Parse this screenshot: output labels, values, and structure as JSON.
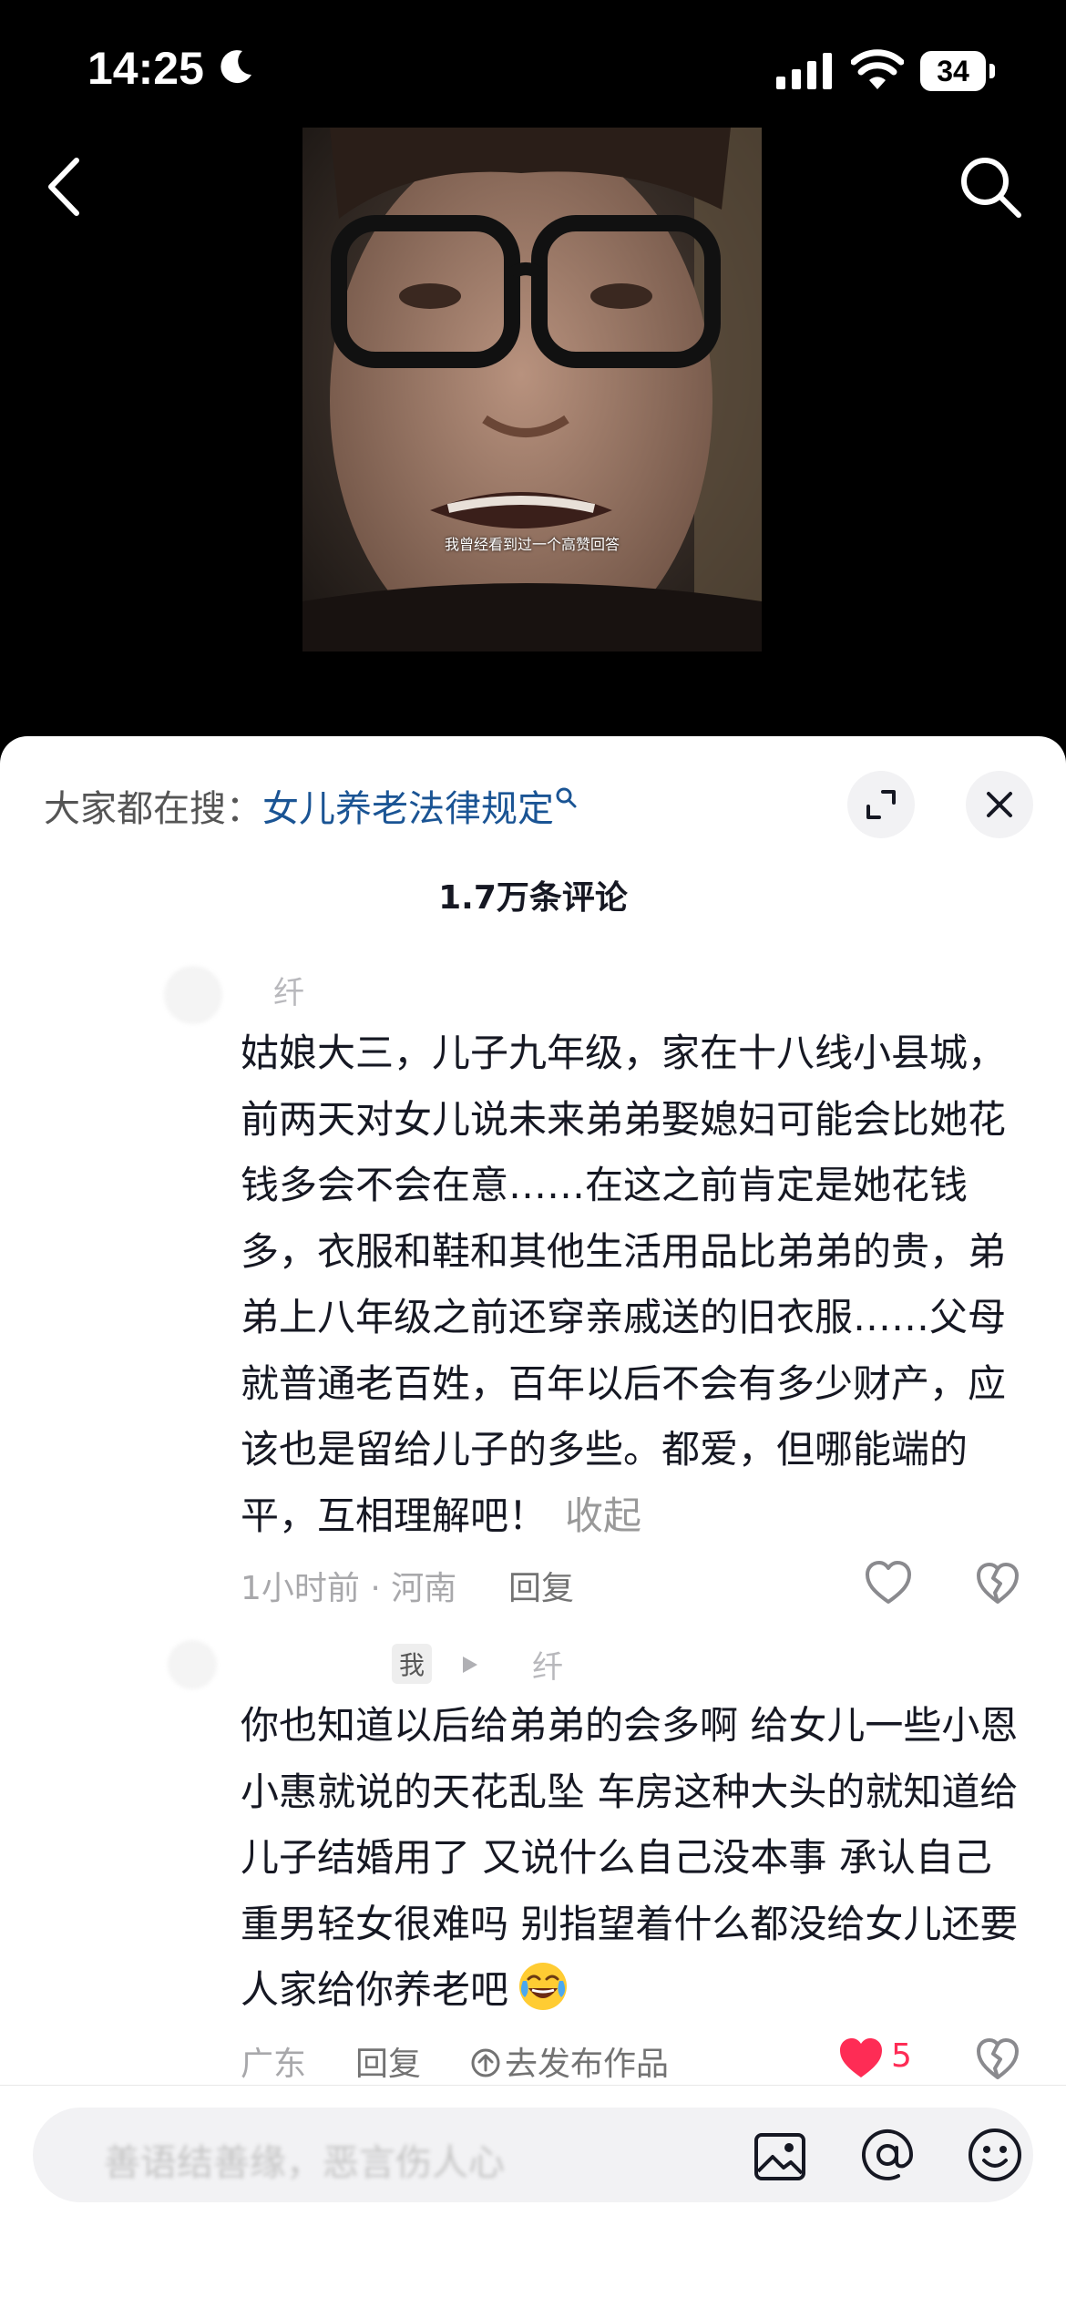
{
  "status_bar": {
    "time": "14:25",
    "battery": "34"
  },
  "video": {
    "subtitle": "我曾经看到过一个高赞回答"
  },
  "hot_search": {
    "label": "大家都在搜：",
    "query": "女儿养老法律规定"
  },
  "comments_header": {
    "count_label": "1.7万条评论"
  },
  "comments": [
    {
      "username": "纤",
      "text": "姑娘大三，儿子九年级，家在十八线小县城，前两天对女儿说未来弟弟娶媳妇可能会比她花钱多会不会在意……在这之前肯定是她花钱多，衣服和鞋和其他生活用品比弟弟的贵，弟弟上八年级之前还穿亲戚送的旧衣服……父母就普通老百姓，百年以后不会有多少财产，应该也是留给儿子的多些。都爱，但哪能端的平，互相理解吧！",
      "collapse_label": "收起",
      "meta": "1小时前 · 河南",
      "reply_label": "回复"
    },
    {
      "me_tag": "我",
      "reply_to": "纤",
      "text": "你也知道以后给弟弟的会多啊 给女儿一些小恩小惠就说的天花乱坠 车房这种大头的就知道给儿子结婚用了 又说什么自己没本事 承认自己重男轻女很难吗 别指望着什么都没给女儿还要人家给你养老吧",
      "location": "广东",
      "reply_label": "回复",
      "publish_label": "去发布作品",
      "likes": "5"
    }
  ],
  "input_bar": {
    "placeholder": "善语结善缘，恶言伤人心"
  },
  "colors": {
    "accent": "#fe2c55",
    "link": "#1a5494"
  }
}
